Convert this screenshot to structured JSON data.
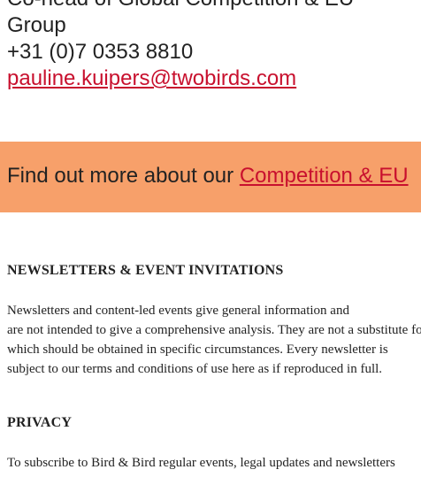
{
  "contact": {
    "role_line1": "Co-head of Global Competition & EU",
    "role_line2": "Group",
    "phone": "+31 (0)7 0353 8810",
    "email": "pauline.kuipers@twobirds.com"
  },
  "banner": {
    "prefix": "Find out more about our ",
    "link": "Competition & EU"
  },
  "newsletters": {
    "heading": "NEWSLETTERS & EVENT INVITATIONS",
    "lines": [
      "Newsletters and content-led events give general information and",
      "are not intended to give a comprehensive analysis. They are not a substitute for legal advice,",
      "which should be obtained in specific circumstances. Every newsletter is",
      "subject to our terms and conditions of use here as if reproduced in full."
    ]
  },
  "privacy": {
    "heading": "PRIVACY",
    "line": "To subscribe to Bird & Bird regular events, legal updates and newsletters"
  },
  "colors": {
    "banner_bg": "#f7a06a",
    "link": "#c8102e",
    "text": "#222222"
  }
}
